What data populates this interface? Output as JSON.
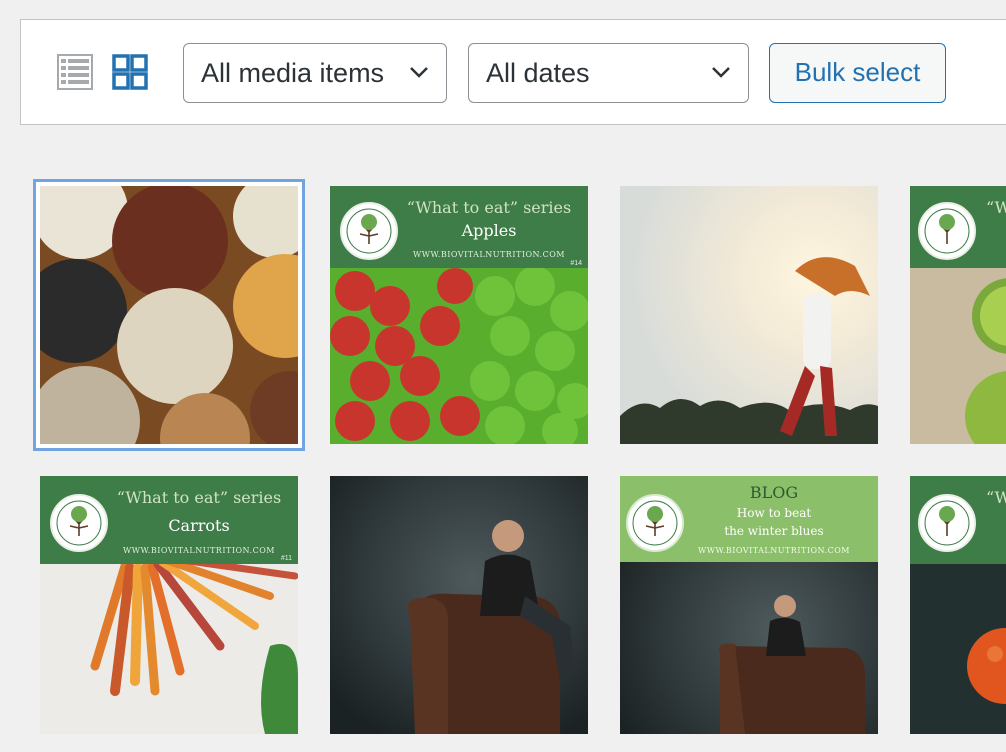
{
  "toolbar": {
    "list_view_icon": "list-view-icon",
    "grid_view_icon": "grid-view-icon",
    "media_filter": "All media items",
    "date_filter": "All dates",
    "bulk_select": "Bulk select"
  },
  "media": [
    {
      "alt": "bowls of seeds and grains",
      "selected": true
    },
    {
      "series": "“What to eat” series",
      "title": "Apples",
      "url": "WWW.BIOVITALNUTRITION.COM",
      "num": "#14"
    },
    {
      "alt": "woman running at sunrise"
    },
    {
      "series": "“W",
      "title": "",
      "url": "",
      "partial": true
    },
    {
      "series": "“What to eat” series",
      "title": "Carrots",
      "url": "WWW.BIOVITALNUTRITION.COM",
      "num": "#11"
    },
    {
      "alt": "man sitting in leather armchair"
    },
    {
      "series": "BLOG",
      "title_line1": "How to beat",
      "title_line2": "the winter blues",
      "url": "WWW.BIOVITALNUTRITION.COM"
    },
    {
      "series": "“W",
      "partial": true
    }
  ],
  "logo_text": "BioVitalNutrition",
  "colors": {
    "accent": "#2271b1",
    "banner_green": "#3e7a4a",
    "blog_green": "#8cbf6a"
  }
}
